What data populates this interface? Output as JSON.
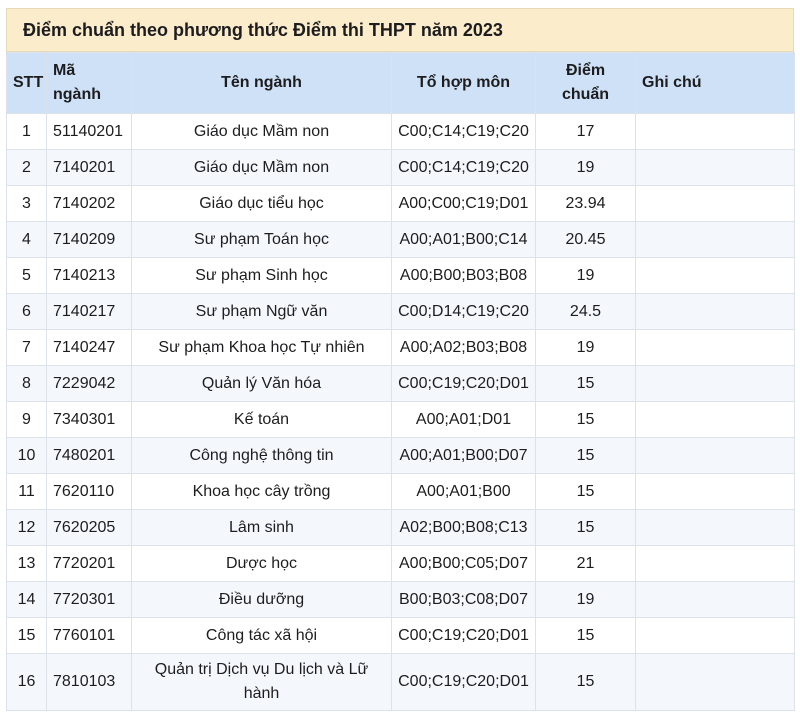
{
  "title": "Điểm chuẩn theo phương thức Điểm thi THPT năm 2023",
  "columns": [
    "STT",
    "Mã ngành",
    "Tên ngành",
    "Tổ hợp môn",
    "Điểm chuẩn",
    "Ghi chú"
  ],
  "rows": [
    [
      "1",
      "51140201",
      "Giáo dục Mầm non",
      "C00;C14;C19;C20",
      "17",
      ""
    ],
    [
      "2",
      "7140201",
      "Giáo dục Mầm non",
      "C00;C14;C19;C20",
      "19",
      ""
    ],
    [
      "3",
      "7140202",
      "Giáo dục tiểu học",
      "A00;C00;C19;D01",
      "23.94",
      ""
    ],
    [
      "4",
      "7140209",
      "Sư phạm Toán học",
      "A00;A01;B00;C14",
      "20.45",
      ""
    ],
    [
      "5",
      "7140213",
      "Sư phạm Sinh học",
      "A00;B00;B03;B08",
      "19",
      ""
    ],
    [
      "6",
      "7140217",
      "Sư phạm Ngữ văn",
      "C00;D14;C19;C20",
      "24.5",
      ""
    ],
    [
      "7",
      "7140247",
      "Sư phạm Khoa học Tự nhiên",
      "A00;A02;B03;B08",
      "19",
      ""
    ],
    [
      "8",
      "7229042",
      "Quản lý Văn hóa",
      "C00;C19;C20;D01",
      "15",
      ""
    ],
    [
      "9",
      "7340301",
      "Kế toán",
      "A00;A01;D01",
      "15",
      ""
    ],
    [
      "10",
      "7480201",
      "Công nghệ thông tin",
      "A00;A01;B00;D07",
      "15",
      ""
    ],
    [
      "11",
      "7620110",
      "Khoa học cây trồng",
      "A00;A01;B00",
      "15",
      ""
    ],
    [
      "12",
      "7620205",
      "Lâm sinh",
      "A02;B00;B08;C13",
      "15",
      ""
    ],
    [
      "13",
      "7720201",
      "Dược học",
      "A00;B00;C05;D07",
      "21",
      ""
    ],
    [
      "14",
      "7720301",
      "Điều dưỡng",
      "B00;B03;C08;D07",
      "19",
      ""
    ],
    [
      "15",
      "7760101",
      "Công tác xã hội",
      "C00;C19;C20;D01",
      "15",
      ""
    ],
    [
      "16",
      "7810103",
      "Quản trị Dịch vụ Du lịch và Lữ hành",
      "C00;C19;C20;D01",
      "15",
      ""
    ]
  ]
}
